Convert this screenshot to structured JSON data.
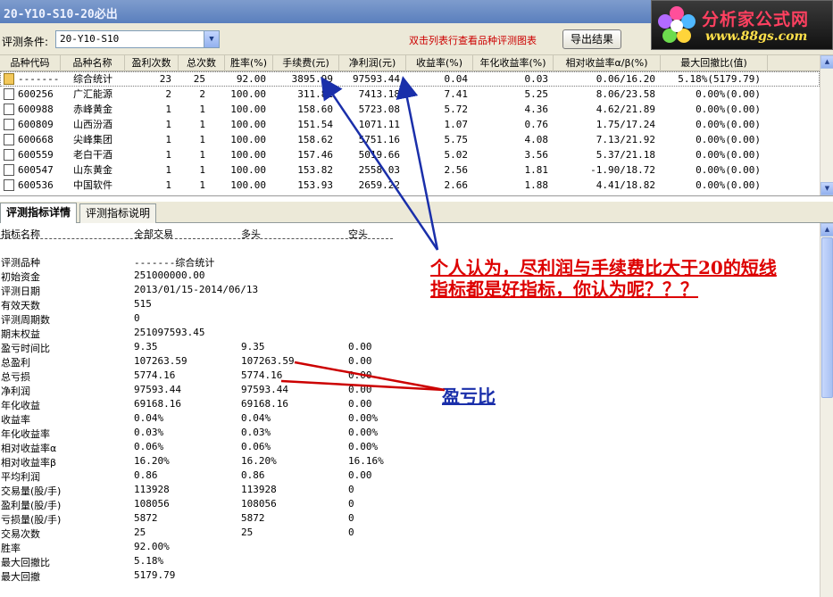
{
  "window": {
    "title": "20-Y10-S10-20必出"
  },
  "logo": {
    "brand": "分析家公式网",
    "site": "www.88gs.com"
  },
  "toolbar": {
    "condition_label": "评测条件:",
    "condition_value": "20-Y10-S10",
    "hint": "双击列表行查看品种评测图表",
    "export_label": "导出结果"
  },
  "table": {
    "columns": [
      "品种代码",
      "品种名称",
      "盈利次数",
      "总次数",
      "胜率(%)",
      "手续费(元)",
      "净利润(元)",
      "收益率(%)",
      "年化收益率(%)",
      "相对收益率α/β(%)",
      "最大回撤比(值)"
    ],
    "rows": [
      {
        "code": "-------",
        "name": "综合统计",
        "wins": "23",
        "total": "25",
        "winrate": "92.00",
        "fee": "3895.99",
        "profit": "97593.44",
        "ret": "0.04",
        "annual": "0.03",
        "rel": "0.06/16.20",
        "dd": "5.18%(5179.79)"
      },
      {
        "code": "600256",
        "name": "广汇能源",
        "wins": "2",
        "total": "2",
        "winrate": "100.00",
        "fee": "311.81",
        "profit": "7413.18",
        "ret": "7.41",
        "annual": "5.25",
        "rel": "8.06/23.58",
        "dd": "0.00%(0.00)"
      },
      {
        "code": "600988",
        "name": "赤峰黄金",
        "wins": "1",
        "total": "1",
        "winrate": "100.00",
        "fee": "158.60",
        "profit": "5723.08",
        "ret": "5.72",
        "annual": "4.36",
        "rel": "4.62/21.89",
        "dd": "0.00%(0.00)"
      },
      {
        "code": "600809",
        "name": "山西汾酒",
        "wins": "1",
        "total": "1",
        "winrate": "100.00",
        "fee": "151.54",
        "profit": "1071.11",
        "ret": "1.07",
        "annual": "0.76",
        "rel": "1.75/17.24",
        "dd": "0.00%(0.00)"
      },
      {
        "code": "600668",
        "name": "尖峰集团",
        "wins": "1",
        "total": "1",
        "winrate": "100.00",
        "fee": "158.62",
        "profit": "5751.16",
        "ret": "5.75",
        "annual": "4.08",
        "rel": "7.13/21.92",
        "dd": "0.00%(0.00)"
      },
      {
        "code": "600559",
        "name": "老白干酒",
        "wins": "1",
        "total": "1",
        "winrate": "100.00",
        "fee": "157.46",
        "profit": "5019.66",
        "ret": "5.02",
        "annual": "3.56",
        "rel": "5.37/21.18",
        "dd": "0.00%(0.00)"
      },
      {
        "code": "600547",
        "name": "山东黄金",
        "wins": "1",
        "total": "1",
        "winrate": "100.00",
        "fee": "153.82",
        "profit": "2558.03",
        "ret": "2.56",
        "annual": "1.81",
        "rel": "-1.90/18.72",
        "dd": "0.00%(0.00)"
      },
      {
        "code": "600536",
        "name": "中国软件",
        "wins": "1",
        "total": "1",
        "winrate": "100.00",
        "fee": "153.93",
        "profit": "2659.22",
        "ret": "2.66",
        "annual": "1.88",
        "rel": "4.41/18.82",
        "dd": "0.00%(0.00)"
      }
    ]
  },
  "tabs": [
    {
      "label": "评测指标详情",
      "active": true
    },
    {
      "label": "评测指标说明",
      "active": false
    }
  ],
  "detail": {
    "headers": [
      "指标名称",
      "全部交易",
      "多头",
      "空头"
    ],
    "rows": [
      [
        "评测品种",
        "-------综合统计",
        "",
        ""
      ],
      [
        "初始资金",
        "251000000.00",
        "",
        ""
      ],
      [
        "评测日期",
        "2013/01/15-2014/06/13",
        "",
        ""
      ],
      [
        "有效天数",
        "515",
        "",
        ""
      ],
      [
        "评测周期数",
        "0",
        "",
        ""
      ],
      [
        "期末权益",
        "251097593.45",
        "",
        ""
      ],
      [
        "盈亏时间比",
        "9.35",
        "9.35",
        "0.00"
      ],
      [
        "总盈利",
        "107263.59",
        "107263.59",
        "0.00"
      ],
      [
        "总亏损",
        "5774.16",
        "5774.16",
        "0.00"
      ],
      [
        "净利润",
        "97593.44",
        "97593.44",
        "0.00"
      ],
      [
        "年化收益",
        "69168.16",
        "69168.16",
        "0.00"
      ],
      [
        "收益率",
        "0.04%",
        "0.04%",
        "0.00%"
      ],
      [
        "年化收益率",
        "0.03%",
        "0.03%",
        "0.00%"
      ],
      [
        "相对收益率α",
        "0.06%",
        "0.06%",
        "0.00%"
      ],
      [
        "相对收益率β",
        "16.20%",
        "16.20%",
        "16.16%"
      ],
      [
        "平均利润",
        "0.86",
        "0.86",
        "0.00"
      ],
      [
        "交易量(股/手)",
        "113928",
        "113928",
        "0"
      ],
      [
        "盈利量(股/手)",
        "108056",
        "108056",
        "0"
      ],
      [
        "亏损量(股/手)",
        "5872",
        "5872",
        "0"
      ],
      [
        "交易次数",
        "25",
        "25",
        "0"
      ],
      [
        "胜率",
        "92.00%",
        "",
        ""
      ],
      [
        "最大回撤比",
        "5.18%",
        "",
        ""
      ],
      [
        "最大回撤",
        "5179.79",
        "",
        ""
      ]
    ]
  },
  "annotations": {
    "opinion": "个人认为，尽利润与手续费比大于20的短线指标都是好指标，你认为呢？？？",
    "ratio_label": "盈亏比"
  },
  "colors": {
    "annotation_red": "#dd0000",
    "annotation_blue": "#1a2faa",
    "arrow_red": "#cc0000",
    "arrow_blue": "#1a2faa"
  }
}
